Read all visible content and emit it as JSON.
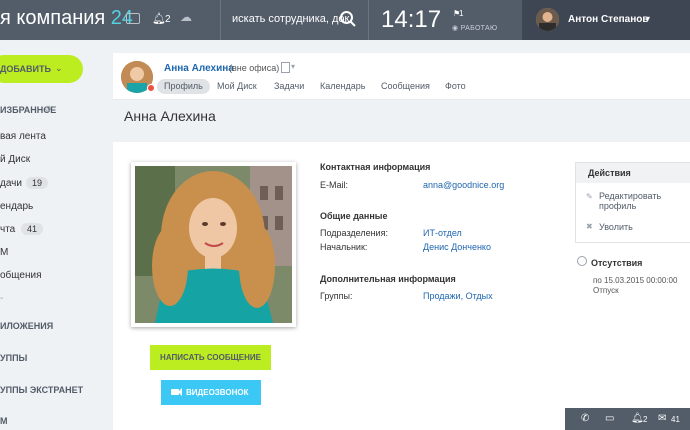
{
  "topbar": {
    "company_prefix": "я компания",
    "company_number": "24",
    "notifications_count": "2",
    "search_placeholder": "искать сотрудника, док",
    "clock": "14:17",
    "tasks_count": "1",
    "status": "РАБОТАЮ",
    "user_name": "Антон Степанов"
  },
  "sidebar": {
    "add_label": "ДОБАВИТЬ",
    "items": [
      {
        "label": "ИЗБРАННОЕ",
        "header": true
      },
      {
        "label": "вая лента"
      },
      {
        "label": "й Диск"
      },
      {
        "label": "дачи",
        "count": "19"
      },
      {
        "label": "ендарь"
      },
      {
        "label": "чта",
        "count": "41"
      },
      {
        "label": "М"
      },
      {
        "label": "общения"
      },
      {
        "label": "-"
      },
      {
        "label": "ИЛОЖЕНИЯ",
        "header": true
      },
      {
        "label": "УППЫ",
        "header": true
      },
      {
        "label": "УППЫ ЭКСТРАНЕТ",
        "header": true
      },
      {
        "label": "М",
        "header": true
      }
    ]
  },
  "profile_header": {
    "name": "Анна Алехина",
    "status": "(вне офиса)",
    "tabs": [
      "Профиль",
      "Мой Диск",
      "Задачи",
      "Календарь",
      "Сообщения",
      "Фото"
    ]
  },
  "page_title": "Анна Алехина",
  "buttons": {
    "message": "НАПИСАТЬ СООБЩЕНИЕ",
    "video": "ВИДЕОЗВОНОК"
  },
  "contact": {
    "title": "Контактная информация",
    "email_label": "E-Mail:",
    "email_value": "anna@goodnice.org"
  },
  "general": {
    "title": "Общие данные",
    "dept_label": "Подразделения:",
    "dept_value": "ИТ-отдел",
    "boss_label": "Начальник:",
    "boss_value": "Денис Донченко"
  },
  "additional": {
    "title": "Дополнительная информация",
    "groups_label": "Группы:",
    "groups_value": "Продажи, Отдых"
  },
  "actions": {
    "title": "Действия",
    "edit_line1": "Редактировать",
    "edit_line2": "профиль",
    "fire": "Уволить"
  },
  "absence": {
    "title": "Отсутствия",
    "dates": "по 15.03.2015 00:00:00",
    "type": "Отпуск"
  },
  "bottom_bar": {
    "notifications": "2",
    "mail": "41"
  },
  "colors": {
    "topbar": "#535c69",
    "accent_green": "#bbed21",
    "accent_blue": "#3bc8f5",
    "link": "#2067b0"
  }
}
